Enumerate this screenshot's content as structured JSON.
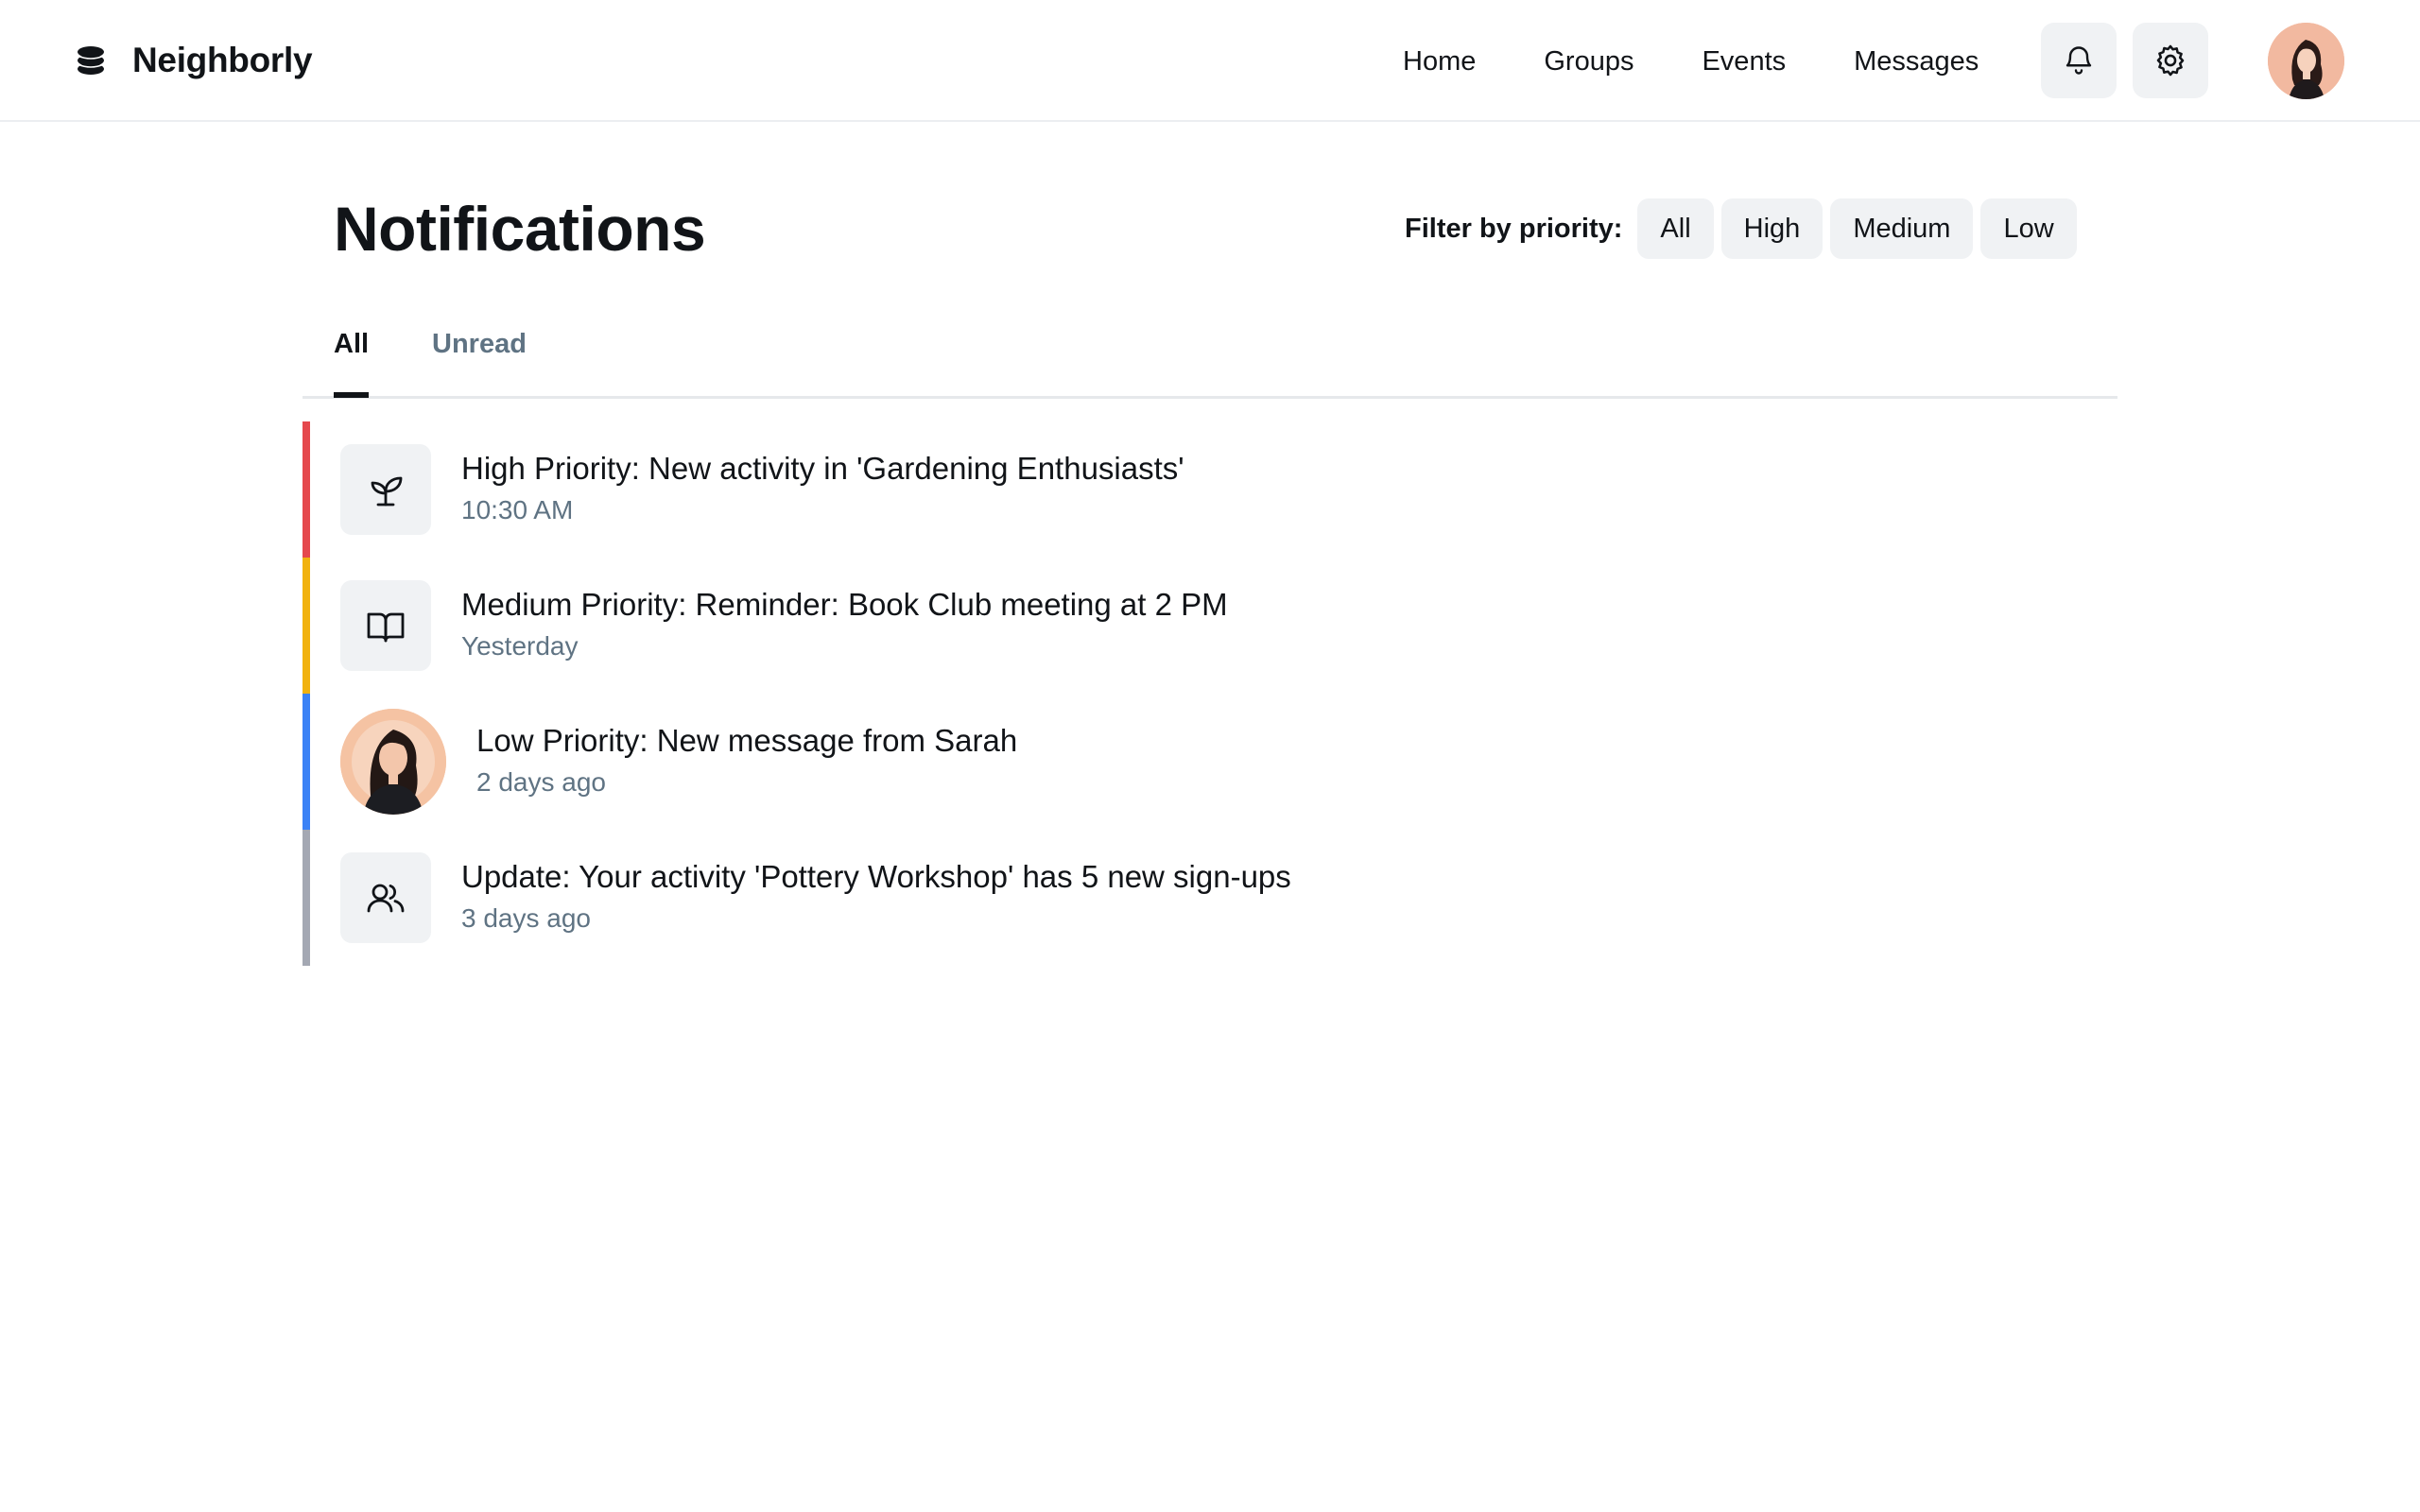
{
  "app": {
    "name": "Neighborly",
    "logo_icon": "stacked-discs-logo-icon"
  },
  "nav": {
    "items": [
      {
        "label": "Home"
      },
      {
        "label": "Groups"
      },
      {
        "label": "Events"
      },
      {
        "label": "Messages"
      }
    ],
    "icons": [
      "bell-icon",
      "gear-icon"
    ],
    "avatar": "user-avatar"
  },
  "page": {
    "title": "Notifications"
  },
  "filter": {
    "label": "Filter by priority:",
    "options": [
      {
        "label": "All"
      },
      {
        "label": "High"
      },
      {
        "label": "Medium"
      },
      {
        "label": "Low"
      }
    ]
  },
  "tabs": [
    {
      "label": "All",
      "active": true
    },
    {
      "label": "Unread",
      "active": false
    }
  ],
  "notifications": [
    {
      "title": "High Priority: New activity in 'Gardening Enthusiasts'",
      "time": "10:30 AM",
      "icon": "sprout-icon",
      "color": "#e5484d"
    },
    {
      "title": "Medium Priority: Reminder: Book Club meeting at 2 PM",
      "time": "Yesterday",
      "icon": "open-book-icon",
      "color": "#f1b20f"
    },
    {
      "title": "Low Priority: New message from Sarah",
      "time": "2 days ago",
      "icon": "sarah-avatar",
      "color": "#3b82f6"
    },
    {
      "title": "Update: Your activity 'Pottery Workshop' has 5 new sign-ups",
      "time": "3 days ago",
      "icon": "users-icon",
      "color": "#a4a8b3"
    }
  ]
}
